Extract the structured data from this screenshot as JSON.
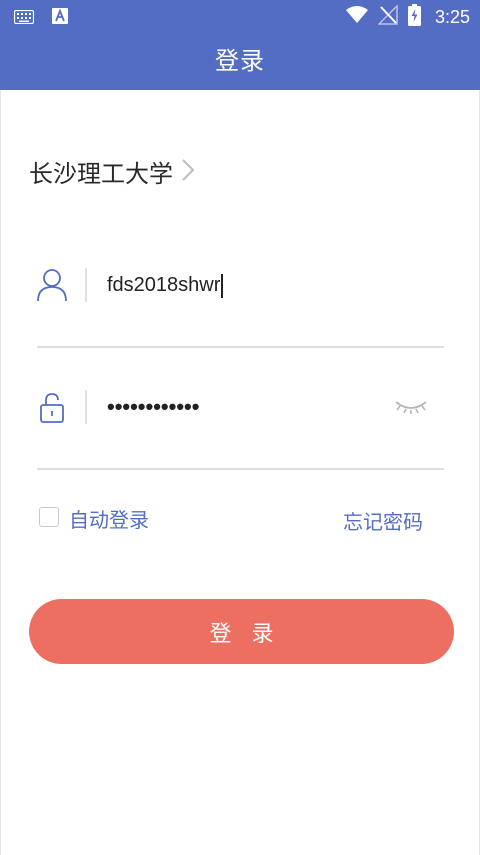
{
  "status_bar": {
    "time": "3:25",
    "icons": [
      "keyboard-icon",
      "app-a-icon",
      "wifi-icon",
      "no-signal-icon",
      "battery-charging-icon"
    ]
  },
  "header": {
    "title": "登录"
  },
  "school": {
    "name": "长沙理工大学",
    "chevron": "chevron-right-icon"
  },
  "username": {
    "value": "fds2018shwr",
    "icon": "user-icon"
  },
  "password": {
    "masked_value": "••••••••••••",
    "icon": "lock-icon",
    "toggle_icon": "eye-closed-icon"
  },
  "options": {
    "auto_login_label": "自动登录",
    "auto_login_checked": false,
    "forgot_password_label": "忘记密码"
  },
  "login_button": {
    "label": "登录"
  },
  "colors": {
    "primary": "#546dc4",
    "button": "#ec6f61"
  }
}
